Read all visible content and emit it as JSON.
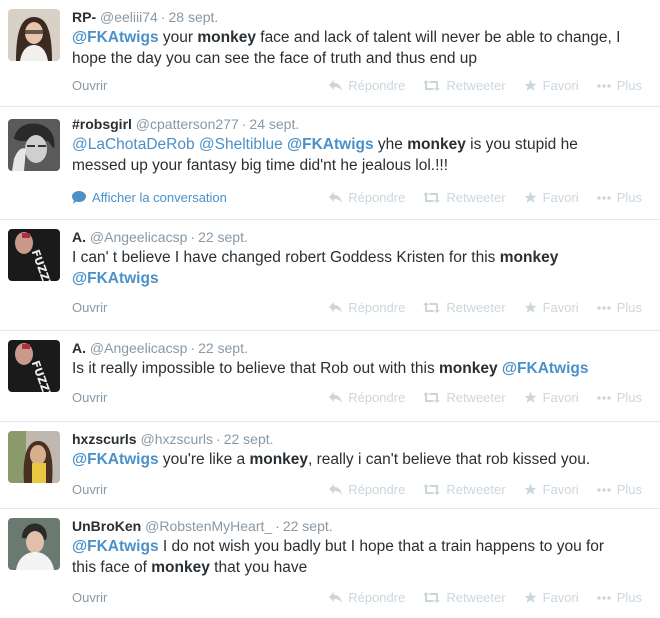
{
  "actions": {
    "reply": "Répondre",
    "retweet": "Retweeter",
    "favorite": "Favori",
    "more": "Plus"
  },
  "tweets": [
    {
      "fullname": "RP-",
      "username": "@eeliii74",
      "time": "28 sept.",
      "expand": "Ouvrir",
      "t1_mention": "@FKAtwigs",
      "t1_a": " your ",
      "t1_kw": "monkey",
      "t1_b": " face and lack of talent will never be able to change, I",
      "t2": "hope the day you can see the face of truth and thus end up"
    },
    {
      "fullname": "#robsgirl",
      "username": "@cpatterson277",
      "time": "24 sept.",
      "expand": "Afficher la conversation",
      "t1_m1": "@LaChotaDeRob",
      "t1_m2": "@Sheltiblue",
      "t1_m3": "@FKAtwigs",
      "t1_a": " yhe ",
      "t1_kw": "monkey",
      "t1_b": " is you stupid he",
      "t2": "messed up your fantasy big time did'nt he jealous lol.!!!"
    },
    {
      "fullname": "A.",
      "username": "@Angeelicacsp",
      "time": "22 sept.",
      "expand": "Ouvrir",
      "t1_a": "I can' t believe I have changed robert Goddess Kristen for this ",
      "t1_kw": "monkey",
      "t2_mention": "@FKAtwigs"
    },
    {
      "fullname": "A.",
      "username": "@Angeelicacsp",
      "time": "22 sept.",
      "expand": "Ouvrir",
      "t1_a": "Is it really impossible to believe that Rob out with this ",
      "t1_kw": "monkey",
      "t1_mention": "@FKAtwigs"
    },
    {
      "fullname": "hxzscurls",
      "username": "@hxzscurls",
      "time": "22 sept.",
      "expand": "Ouvrir",
      "t1_mention": "@FKAtwigs",
      "t1_a": " you're like a ",
      "t1_kw": "monkey",
      "t1_b": ", really i can't believe that rob kissed you."
    },
    {
      "fullname": "UnBroKen",
      "username": "@RobstenMyHeart_",
      "time": "22 sept.",
      "expand": "Ouvrir",
      "t1_mention": "@FKAtwigs",
      "t1_a": " I do not wish you badly but I hope that a train happens to you for",
      "t2_a": "this face of ",
      "t2_kw": "monkey",
      "t2_b": " that you have"
    }
  ]
}
